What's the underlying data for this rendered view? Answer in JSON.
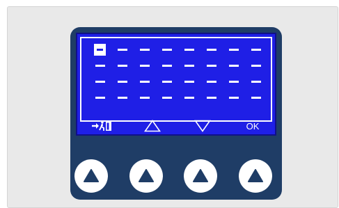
{
  "softkeys": {
    "exit_icon": "exit-door-icon",
    "up_icon": "triangle-up-outline-icon",
    "down_icon": "triangle-down-outline-icon",
    "ok_label": "OK"
  },
  "display": {
    "rows": 4,
    "cols": 8,
    "cursor": {
      "row": 1,
      "col": 1
    },
    "placeholder_char": "-"
  },
  "hardware_buttons": [
    {
      "icon": "triangle-up-filled-icon"
    },
    {
      "icon": "triangle-up-filled-icon"
    },
    {
      "icon": "triangle-up-filled-icon"
    },
    {
      "icon": "triangle-up-filled-icon"
    }
  ],
  "colors": {
    "screen_blue": "#1f1fe6",
    "device_navy": "#1f3d66",
    "foreground": "#ffffff"
  }
}
